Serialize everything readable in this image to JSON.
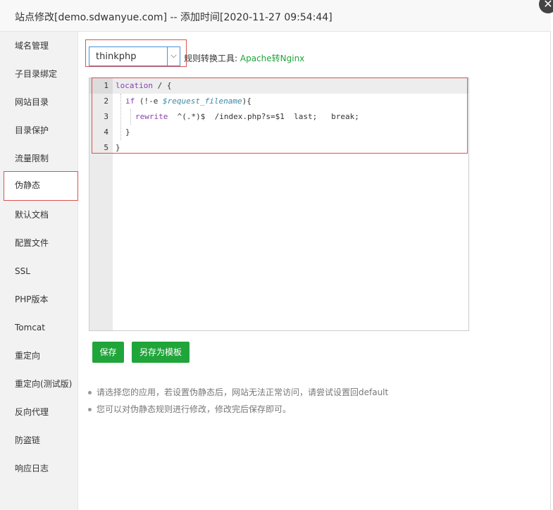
{
  "title": "站点修改[demo.sdwanyue.com] -- 添加时间[2020-11-27 09:54:44]",
  "close_glyph": "✕",
  "sidebar": {
    "items": [
      {
        "label": "域名管理"
      },
      {
        "label": "子目录绑定"
      },
      {
        "label": "网站目录"
      },
      {
        "label": "目录保护"
      },
      {
        "label": "流量限制"
      },
      {
        "label": "伪静态",
        "active": true
      },
      {
        "label": "默认文档"
      },
      {
        "label": "配置文件"
      },
      {
        "label": "SSL"
      },
      {
        "label": "PHP版本"
      },
      {
        "label": "Tomcat"
      },
      {
        "label": "重定向"
      },
      {
        "label": "重定向(测试版)"
      },
      {
        "label": "反向代理"
      },
      {
        "label": "防盗链"
      },
      {
        "label": "响应日志"
      }
    ]
  },
  "rewrite": {
    "selected_template": "thinkphp",
    "converter_label": "规则转换工具:",
    "converter_link": "Apache转Nginx"
  },
  "editor": {
    "line_numbers": [
      "1",
      "2",
      "3",
      "4",
      "5"
    ],
    "lines": {
      "l1_kw": "location",
      "l1_rest": " / {",
      "l2_kw": "if",
      "l2_a": " (!-e ",
      "l2_var": "$request_filename",
      "l2_b": "){",
      "l3_kw": "rewrite",
      "l3_rest": "  ^(.*)$  /index.php?s=$1  last;   break;",
      "l4": "}",
      "l5": "}"
    }
  },
  "buttons": {
    "save": "保存",
    "save_as_template": "另存为模板"
  },
  "tips": [
    "请选择您的应用，若设置伪静态后，网站无法正常访问，请尝试设置回default",
    "您可以对伪静态规则进行修改，修改完后保存即可。"
  ],
  "colors": {
    "accent_green": "#20a53a",
    "highlight_red": "#d9534f",
    "keyword_purple": "#8b3fb0"
  }
}
